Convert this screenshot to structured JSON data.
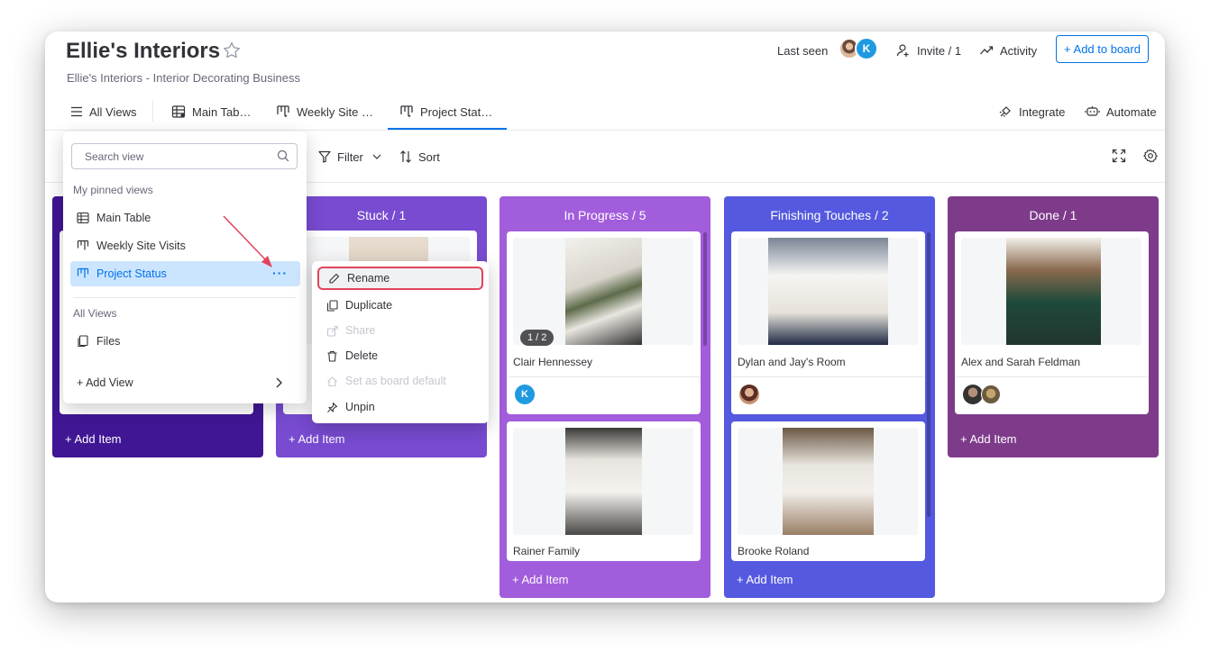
{
  "board": {
    "title": "Ellie's Interiors",
    "subtitle": "Ellie's Interiors - Interior Decorating Business"
  },
  "header": {
    "last_seen": "Last seen",
    "avatar_k": "K",
    "invite": "Invite / 1",
    "activity": "Activity",
    "add_to_board": "+ Add to board"
  },
  "tabs": {
    "all_views": "All Views",
    "items": [
      "Main Tab…",
      "Weekly Site …",
      "Project Stat…"
    ],
    "integrate": "Integrate",
    "automate": "Automate"
  },
  "toolbar": {
    "filter": "Filter",
    "sort": "Sort"
  },
  "columns": [
    {
      "title": "",
      "color": "#401694",
      "add_item": "+ Add Item"
    },
    {
      "title": "Stuck / 1",
      "color": "#784bd1",
      "add_item": "+ Add Item"
    },
    {
      "title": "In Progress / 5",
      "color": "#a25ddc",
      "add_item": "+ Add Item"
    },
    {
      "title": "Finishing Touches / 2",
      "color": "#5559df",
      "add_item": "+ Add Item"
    },
    {
      "title": "Done / 1",
      "color": "#7e3b8a",
      "add_item": "+ Add Item"
    }
  ],
  "cards": {
    "in_progress_1": {
      "title": "Clair Hennessey",
      "badge": "1 / 2",
      "person": "K"
    },
    "in_progress_2": {
      "title": "Rainer Family"
    },
    "finishing_1": {
      "title": "Dylan and Jay's Room"
    },
    "finishing_2": {
      "title": "Brooke Roland"
    },
    "done_1": {
      "title": "Alex and Sarah Feldman"
    }
  },
  "views_menu": {
    "search_placeholder": "Search view",
    "pinned_label": "My pinned views",
    "pinned": [
      "Main Table",
      "Weekly Site Visits",
      "Project Status"
    ],
    "dots": "···",
    "all_views_label": "All Views",
    "all_views": [
      "Files"
    ],
    "add_view": "+ Add View"
  },
  "context_menu": {
    "items": [
      {
        "label": "Rename",
        "enabled": true
      },
      {
        "label": "Duplicate",
        "enabled": true
      },
      {
        "label": "Share",
        "enabled": false
      },
      {
        "label": "Delete",
        "enabled": true
      },
      {
        "label": "Set as board default",
        "enabled": false
      },
      {
        "label": "Unpin",
        "enabled": true
      }
    ]
  },
  "colors": {
    "accent": "#0073ea",
    "highlight": "#e2445c"
  }
}
